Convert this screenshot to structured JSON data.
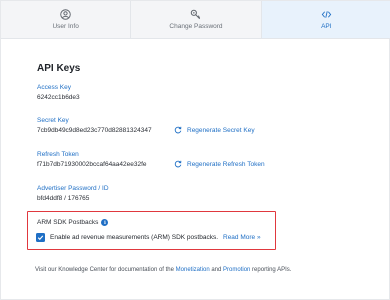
{
  "tabs": [
    {
      "label": "User Info",
      "icon": "user-circle-icon",
      "active": false
    },
    {
      "label": "Change Password",
      "icon": "key-icon",
      "active": false
    },
    {
      "label": "API",
      "icon": "code-icon",
      "active": true
    }
  ],
  "api": {
    "heading": "API Keys",
    "access_key": {
      "label": "Access Key",
      "value": "6242cc1b6de3"
    },
    "secret_key": {
      "label": "Secret Key",
      "value": "7cb9db49c9d8ed23c770d82881324347",
      "action": "Regenerate Secret Key"
    },
    "refresh_token": {
      "label": "Refresh Token",
      "value": "f71b7db71930002bccaf64aa42ee32fe",
      "action": "Regenerate Refresh Token"
    },
    "advertiser": {
      "label": "Advertiser Password / ID",
      "value": "bfd4ddf8 / 176765"
    }
  },
  "arm": {
    "title": "ARM SDK Postbacks",
    "checkbox_label": "Enable ad revenue measurements (ARM) SDK postbacks.",
    "checked": true,
    "read_more": "Read More »"
  },
  "footer": {
    "prefix": "Visit our Knowledge Center for documentation of the ",
    "link1": "Monetization",
    "mid": " and ",
    "link2": "Promotion",
    "suffix": " reporting APIs."
  },
  "colors": {
    "accent": "#1f6fc5",
    "highlight_border": "#e0383e",
    "active_tab_bg": "#e8f2fc"
  }
}
